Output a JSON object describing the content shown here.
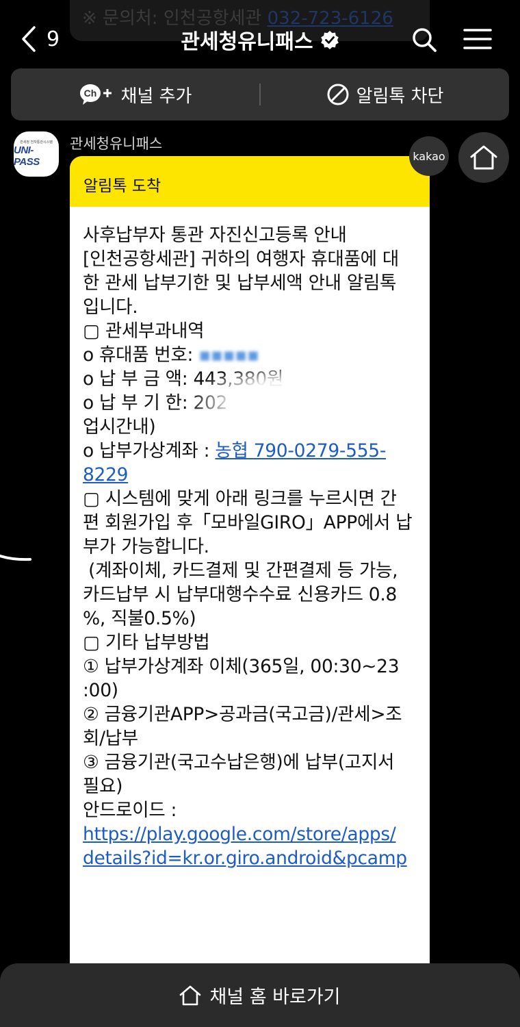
{
  "ghost": {
    "prefix": "※ 문의처: 인천공항세관 ",
    "phone": "032-723-6126"
  },
  "header": {
    "back_count": "9",
    "title": "관세청유니패스",
    "icons": [
      "chevron-left-icon",
      "verified-badge-icon",
      "search-icon",
      "menu-icon"
    ]
  },
  "action_bar": {
    "add_channel_label": "채널 추가",
    "block_label": "알림톡 차단",
    "ch_badge": "Ch"
  },
  "sender": {
    "name": "관세청유니패스",
    "avatar_logo": "UNI-PASS",
    "avatar_sub": "관세청 전자통관시스템"
  },
  "message": {
    "header": "알림톡 도착",
    "intro": [
      "사후납부자 통관 자진신고등록 안내",
      "[인천공항세관] 귀하의 여행자 휴대품에 대",
      "한 관세 납부기한 및 납부세액 안내 알림톡",
      "입니다."
    ],
    "section1_title": "▢ 관세부과내역",
    "item_number_label": "o 휴대품 번호:",
    "item_amount_label": "o 납 부 금 액: 443,380원",
    "item_due_label": "o 납 부 기 한: 202",
    "item_due_cont": "업시간내)",
    "account_label": "o 납부가상계좌 : ",
    "account_link_1": "농협 790-0279-555-",
    "account_link_2": "8229",
    "section2": [
      "▢ 시스템에 맞게 아래 링크를 누르시면 간",
      "편 회원가입 후「모바일GIRO」APP에서 납",
      "부가 가능합니다.",
      " (계좌이체, 카드결제 및 간편결제 등 가능,",
      "카드납부 시 납부대행수수료 신용카드 0.8",
      "%, 직불0.5%)"
    ],
    "section3": [
      "▢ 기타 납부방법",
      "① 납부가상계좌 이체(365일, 00:30~23",
      ":00)",
      "② 금융기관APP>공과금(국고금)/관세>조",
      "회/납부",
      "③ 금융기관(국고수납은행)에 납부(고지서",
      "필요)"
    ],
    "android_label": "안드로이드 :",
    "android_link_1": "https://play.google.com/store/apps/",
    "android_link_2": "details?id=kr.or.giro.android&pcamp"
  },
  "badges": {
    "kakao": "kakao"
  },
  "bottom_bar": {
    "label": "채널 홈 바로가기"
  }
}
